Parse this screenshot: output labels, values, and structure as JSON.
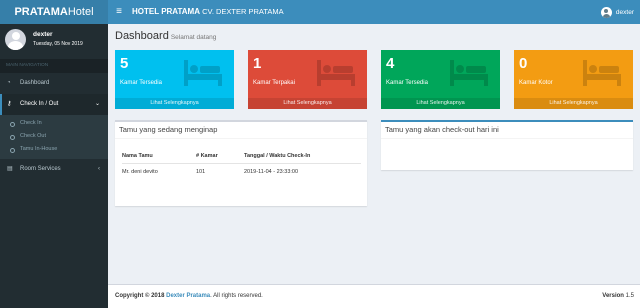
{
  "brand": {
    "bold": "PRATAMA",
    "normal": "Hotel"
  },
  "topbar": {
    "menu_icon": "≡",
    "title_bold": "HOTEL PRATAMA",
    "title_rest": " CV. DEXTER PRATAMA",
    "user": "dexter"
  },
  "sidebar": {
    "user_name": "dexter",
    "user_date": "Tuesday, 05 Nov 2019",
    "header": "MAIN NAVIGATION",
    "dashboard": {
      "icon": "speedometer-icon",
      "glyph": "◔",
      "label": "Dashboard"
    },
    "checkinout": {
      "icon": "key-icon",
      "glyph": "⚷",
      "label": "Check In / Out",
      "chevron": "⌄"
    },
    "subitems": [
      "Check In",
      "Check Out",
      "Tamu In-House"
    ],
    "room_services": {
      "icon": "list-icon",
      "glyph": "▤",
      "label": "Room Services",
      "chevron": "‹"
    }
  },
  "page": {
    "title": "Dashboard",
    "subtitle": "Selamat datang"
  },
  "boxes": [
    {
      "value": "5",
      "label": "Kamar Tersedia",
      "link": "Lihat Selengkapnya",
      "color": "#00c0ef"
    },
    {
      "value": "1",
      "label": "Kamar Terpakai",
      "link": "Lihat Selengkapnya",
      "color": "#dd4b39"
    },
    {
      "value": "4",
      "label": "Kamar Tersedia",
      "link": "Lihat Selengkapnya",
      "color": "#00a65a"
    },
    {
      "value": "0",
      "label": "Kamar Kotor",
      "link": "Lihat Selengkapnya",
      "color": "#f39c12"
    }
  ],
  "guests_in": {
    "title": "Tamu yang sedang menginap",
    "headers": [
      "Nama Tamu",
      "# Kamar",
      "Tanggal / Waktu Check-In"
    ],
    "rows": [
      [
        "Mr. deni devito",
        "101",
        "2019-11-04 - 23:33:00"
      ]
    ]
  },
  "guests_out": {
    "title": "Tamu yang akan check-out hari ini"
  },
  "footer": {
    "copy": "Copyright © 2018 ",
    "company": "Dexter Pratama",
    "rights": ". All rights reserved.",
    "version_label": "Version",
    "version": "1.5"
  }
}
